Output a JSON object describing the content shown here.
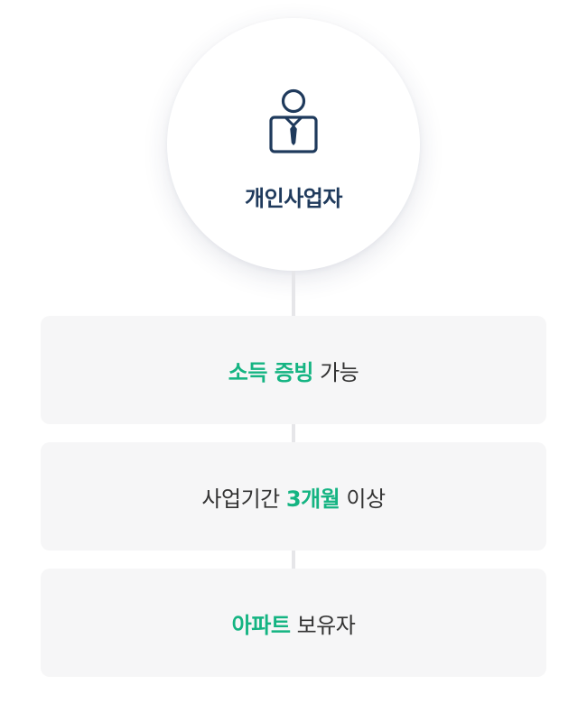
{
  "profile": {
    "label": "개인사업자",
    "icon": "businessman-icon",
    "icon_color": "#1f3a5c"
  },
  "colors": {
    "highlight": "#14b482",
    "text": "#333333",
    "card_bg": "#f6f6f7",
    "connector": "#e6e6e9"
  },
  "requirements": [
    {
      "before": "",
      "highlight": "소득 증빙",
      "after": "가능"
    },
    {
      "before": "사업기간",
      "highlight": "3개월",
      "after": "이상"
    },
    {
      "before": "",
      "highlight": "아파트",
      "after": "보유자"
    }
  ]
}
